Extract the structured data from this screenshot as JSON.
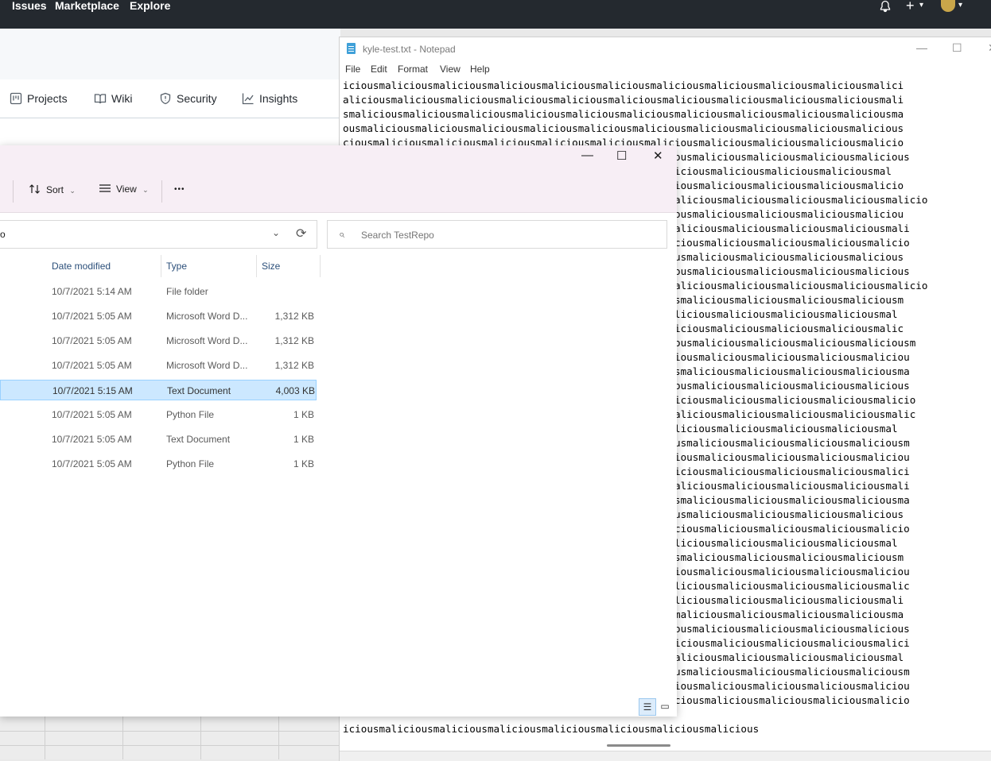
{
  "github": {
    "nav": [
      "Issues",
      "Marketplace",
      "Explore"
    ],
    "tabs": [
      "Projects",
      "Wiki",
      "Security",
      "Insights"
    ],
    "icons": {
      "bell": "bell-icon",
      "plus": "plus-icon",
      "avatar": "avatar"
    },
    "plus_glyph": "+",
    "caret": "▾",
    "bell_glyph": "🔔"
  },
  "notepad": {
    "title": "kyle-test.txt - Notepad",
    "menu": [
      "File",
      "Edit",
      "Format",
      "View",
      "Help"
    ],
    "controls": {
      "minimize": "—",
      "maximize": "☐",
      "close": "✕"
    },
    "lines": [
      "iciousmaliciousmaliciousmaliciousmaliciousmaliciousmaliciousmaliciousmaliciousmaliciousmalici",
      "aliciousmaliciousmaliciousmaliciousmaliciousmaliciousmaliciousmaliciousmaliciousmaliciousmali",
      "smaliciousmaliciousmaliciousmaliciousmaliciousmaliciousmaliciousmaliciousmaliciousmaliciousma",
      "ousmaliciousmaliciousmaliciousmaliciousmaliciousmaliciousmaliciousmaliciousmaliciousmalicious",
      "ciousmaliciousmaliciousmaliciousmaliciousmaliciousmaliciousmaliciousmaliciousmaliciousmalicio",
      "iousmaliciousmaliciousmaliciousmaliciousmaliciousmaliciousmaliciousmaliciousmaliciousmalicious",
      "liciousmaliciousmaliciousmaliciousmaliciousmaliciousmaliciousmaliciousmaliciousmaliciousmal",
      "ciousmaliciousmaliciousmaliciousmaliciousmaliciousmaliciousmaliciousmaliciousmaliciousmalicio",
      "maliciousmaliciousmaliciousmaliciousmaliciousmaliciousmaliciousmaliciousmaliciousmaliciousmalicio",
      "iousmaliciousmaliciousmaliciousmaliciousmaliciousmaliciousmaliciousmaliciousmaliciousmaliciou",
      "maliciousmaliciousmaliciousmaliciousmaliciousmaliciousmaliciousmaliciousmaliciousmaliciousmali",
      "iciousmaliciousmaliciousmaliciousmaliciousmaliciousmaliciousmaliciousmaliciousmaliciousmalicio",
      "ousmaliciousmaliciousmaliciousmaliciousmaliciousmaliciousmaliciousmaliciousmaliciousmalicious",
      "iousmaliciousmaliciousmaliciousmaliciousmaliciousmaliciousmaliciousmaliciousmaliciousmalicious",
      "maliciousmaliciousmaliciousmaliciousmaliciousmaliciousmaliciousmaliciousmaliciousmaliciousmalicio",
      "usmaliciousmaliciousmaliciousmaliciousmaliciousmaliciousmaliciousmaliciousmaliciousmaliciousm",
      "aliciousmaliciousmaliciousmaliciousmaliciousmaliciousmaliciousmaliciousmaliciousmaliciousmal",
      "liciousmaliciousmaliciousmaliciousmaliciousmaliciousmaliciousmaliciousmaliciousmaliciousmalic",
      "sousmaliciousmaliciousmaliciousmaliciousmaliciousmaliciousmaliciousmaliciousmaliciousmaliciousm",
      "ciousmaliciousmaliciousmaliciousmaliciousmaliciousmaliciousmaliciousmaliciousmaliciousmaliciou",
      "usmaliciousmaliciousmaliciousmaliciousmaliciousmaliciousmaliciousmaliciousmaliciousmaliciousma",
      "iousmaliciousmaliciousmaliciousmaliciousmaliciousmaliciousmaliciousmaliciousmaliciousmalicious",
      "liciousmaliciousmaliciousmaliciousmaliciousmaliciousmaliciousmaliciousmaliciousmaliciousmalicio",
      "maliciousmaliciousmaliciousmaliciousmaliciousmaliciousmaliciousmaliciousmaliciousmaliciousmalic",
      "aliciousmaliciousmaliciousmaliciousmaliciousmaliciousmaliciousmaliciousmaliciousmaliciousmal",
      "ousmaliciousmaliciousmaliciousmaliciousmaliciousmaliciousmaliciousmaliciousmaliciousmaliciousm",
      "ciousmaliciousmaliciousmaliciousmaliciousmaliciousmaliciousmaliciousmaliciousmaliciousmaliciou",
      "liciousmaliciousmaliciousmaliciousmaliciousmaliciousmaliciousmaliciousmaliciousmaliciousmalici",
      "maliciousmaliciousmaliciousmaliciousmaliciousmaliciousmaliciousmaliciousmaliciousmaliciousmali",
      "usmaliciousmaliciousmaliciousmaliciousmaliciousmaliciousmaliciousmaliciousmaliciousmaliciousma",
      "ousmaliciousmaliciousmaliciousmaliciousmaliciousmaliciousmaliciousmaliciousmaliciousmalicious",
      "iciousmaliciousmaliciousmaliciousmaliciousmaliciousmaliciousmaliciousmaliciousmaliciousmalicio",
      "aliciousmaliciousmaliciousmaliciousmaliciousmaliciousmaliciousmaliciousmaliciousmaliciousmal",
      "usmaliciousmaliciousmaliciousmaliciousmaliciousmaliciousmaliciousmaliciousmaliciousmaliciousm",
      "ciousmaliciousmaliciousmaliciousmaliciousmaliciousmaliciousmaliciousmaliciousmaliciousmaliciou",
      "aliciousmaliciousmaliciousmaliciousmaliciousmaliciousmaliciousmaliciousmaliciousmaliciousmalic",
      "aliciousmaliciousmaliciousmaliciousmaliciousmaliciousmaliciousmaliciousmaliciousmaliciousmali",
      "smaliciousmaliciousmaliciousmaliciousmaliciousmaliciousmaliciousmaliciousmaliciousmaliciousma",
      "iousmaliciousmaliciousmaliciousmaliciousmaliciousmaliciousmaliciousmaliciousmaliciousmalicious",
      "liciousmaliciousmaliciousmaliciousmaliciousmaliciousmaliciousmaliciousmaliciousmaliciousmalici",
      "maliciousmaliciousmaliciousmaliciousmaliciousmaliciousmaliciousmaliciousmaliciousmaliciousmal",
      "ousmaliciousmaliciousmaliciousmaliciousmaliciousmaliciousmaliciousmaliciousmaliciousmaliciousm",
      "ciousmaliciousmaliciousmaliciousmaliciousmaliciousmaliciousmaliciousmaliciousmaliciousmaliciou",
      "iciousmaliciousmaliciousmaliciousmaliciousmaliciousmaliciousmaliciousmaliciousmaliciousmalicio"
    ],
    "last_line": "iciousmaliciousmaliciousmaliciousmaliciousmaliciousmaliciousmalicious"
  },
  "explorer": {
    "controls": {
      "minimize": "—",
      "maximize": "☐",
      "close": "✕"
    },
    "toolbar": {
      "sort": "Sort",
      "view": "View",
      "more": "•••",
      "chevron": "⌄"
    },
    "address": {
      "text": "o",
      "chevron": "⌄",
      "refresh": "⟳"
    },
    "search": {
      "placeholder": "Search TestRepo",
      "icon": "⌕"
    },
    "columns": [
      "Date modified",
      "Type",
      "Size"
    ],
    "rows": [
      {
        "date": "10/7/2021 5:14 AM",
        "type": "File folder",
        "size": ""
      },
      {
        "date": "10/7/2021 5:05 AM",
        "type": "Microsoft Word D...",
        "size": "1,312 KB"
      },
      {
        "date": "10/7/2021 5:05 AM",
        "type": "Microsoft Word D...",
        "size": "1,312 KB"
      },
      {
        "date": "10/7/2021 5:05 AM",
        "type": "Microsoft Word D...",
        "size": "1,312 KB"
      },
      {
        "date": "10/7/2021 5:15 AM",
        "type": "Text Document",
        "size": "4,003 KB"
      },
      {
        "date": "10/7/2021 5:05 AM",
        "type": "Python File",
        "size": "1 KB"
      },
      {
        "date": "10/7/2021 5:05 AM",
        "type": "Text Document",
        "size": "1 KB"
      },
      {
        "date": "10/7/2021 5:05 AM",
        "type": "Python File",
        "size": "1 KB"
      }
    ],
    "selected_row": 4,
    "view_buttons": {
      "details": "☰",
      "tiles": "▭"
    }
  }
}
